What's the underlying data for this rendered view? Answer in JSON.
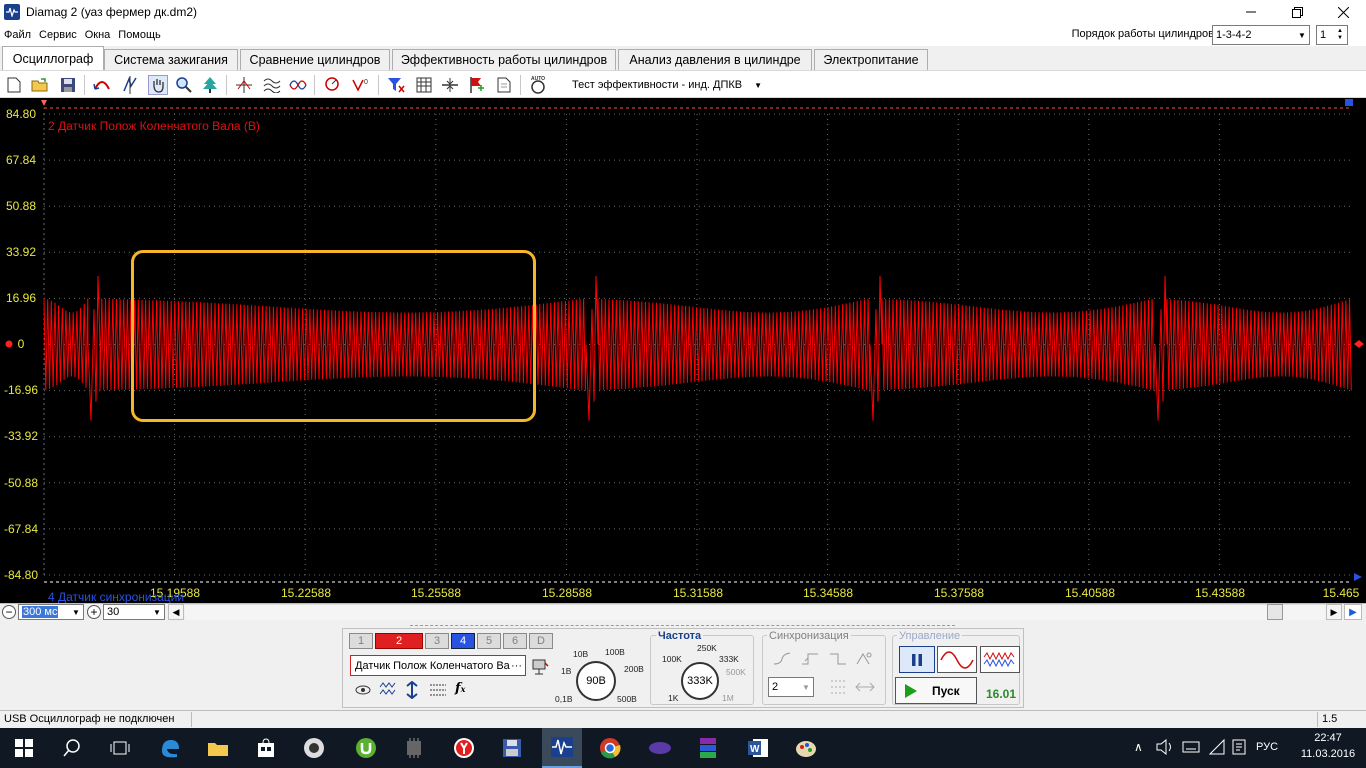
{
  "window": {
    "title": "Diamag 2 (уаз фермер дк.dm2)"
  },
  "menu": [
    "Файл",
    "Сервис",
    "Окна",
    "Помощь"
  ],
  "cylinder_order": {
    "label": "Порядок работы цилиндров",
    "value": "1-3-4-2",
    "count": "1"
  },
  "tabs": [
    "Осциллограф",
    "Система зажигания",
    "Сравнение цилиндров",
    "Эффективность работы цилиндров",
    "Анализ давления в цилиндре",
    "Электропитание"
  ],
  "toolbar": {
    "mode_select": "Тест эффективности - инд. ДПКВ",
    "auto_label": "AUTO"
  },
  "scope": {
    "channel_label": "2 Датчик Полож Коленчатого Вала (В)",
    "channel4_label": "4 Датчик синхронизации",
    "y_ticks": [
      "84.80",
      "67.84",
      "50.88",
      "33.92",
      "16.96",
      "0",
      "-16.96",
      "-33.92",
      "-50.88",
      "-67.84",
      "-84.80"
    ],
    "x_ticks": [
      "15.19588",
      "15.22588",
      "15.25588",
      "15.28588",
      "15.31588",
      "15.34588",
      "15.37588",
      "15.40588",
      "15.43588",
      "15.465"
    ],
    "trace_color": "#ff0000",
    "grid_color": "#6a6a6a",
    "highlight_color": "#f7b52a"
  },
  "timebase": {
    "value": "300 мс",
    "count": "30"
  },
  "channels": {
    "buttons": [
      "1",
      "2",
      "3",
      "4",
      "5",
      "6",
      "D"
    ],
    "active": "2",
    "selected_name": "Датчик Полож Коленчатого Ва"
  },
  "voltage": {
    "value": "90В",
    "scale": [
      "10В",
      "100В",
      "1В",
      "200В",
      "0,1В",
      "500В"
    ]
  },
  "frequency": {
    "title": "Частота",
    "value": "333K",
    "scale": [
      "250K",
      "100K",
      "333K",
      "500K",
      "1K",
      "1M"
    ]
  },
  "sync": {
    "title": "Синхронизация",
    "channel": "2"
  },
  "control": {
    "title": "Управление",
    "start_label": "Пуск",
    "value": "16.01"
  },
  "status": {
    "message": "USB Осциллограф не подключен",
    "right": "1.5"
  },
  "taskbar": {
    "lang": "РУС",
    "time": "22:47",
    "date": "11.03.2016"
  }
}
